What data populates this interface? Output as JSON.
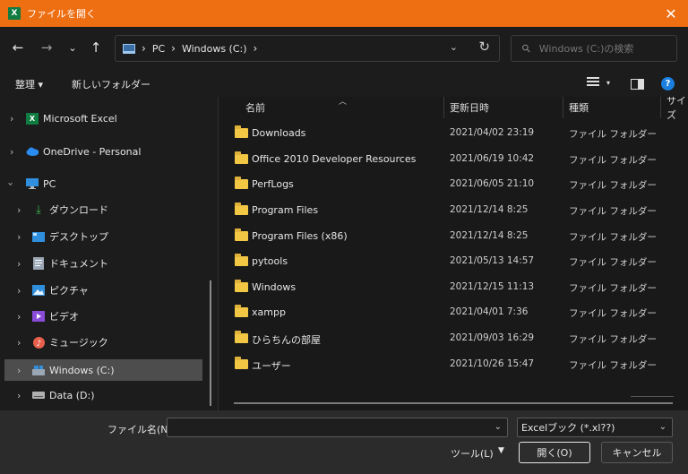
{
  "window": {
    "title": "ファイルを開く",
    "app_badge": "X"
  },
  "nav": {
    "breadcrumb": [
      "PC",
      "Windows (C:)"
    ],
    "search_placeholder": "Windows (C:)の検索"
  },
  "toolbar": {
    "organize_label": "整理 ▾",
    "new_folder_label": "新しいフォルダー",
    "help_label": "?"
  },
  "sidebar": {
    "items": [
      {
        "label": "Microsoft Excel",
        "icon": "excel-icon"
      },
      {
        "label": "OneDrive - Personal",
        "icon": "cloud-icon"
      },
      {
        "label": "PC",
        "icon": "pc-icon"
      },
      {
        "label": "ダウンロード",
        "icon": "download-icon"
      },
      {
        "label": "デスクトップ",
        "icon": "desktop-icon"
      },
      {
        "label": "ドキュメント",
        "icon": "document-icon"
      },
      {
        "label": "ピクチャ",
        "icon": "picture-icon"
      },
      {
        "label": "ビデオ",
        "icon": "video-icon"
      },
      {
        "label": "ミュージック",
        "icon": "music-icon"
      },
      {
        "label": "Windows (C:)",
        "icon": "drive-icon",
        "selected": true
      },
      {
        "label": "Data (D:)",
        "icon": "drive-icon"
      }
    ]
  },
  "columns": {
    "name": "名前",
    "date": "更新日時",
    "type": "種類",
    "size": "サイズ"
  },
  "files": [
    {
      "name": "Downloads",
      "date": "2021/04/02 23:19",
      "type": "ファイル フォルダー"
    },
    {
      "name": "Office 2010 Developer Resources",
      "date": "2021/06/19 10:42",
      "type": "ファイル フォルダー"
    },
    {
      "name": "PerfLogs",
      "date": "2021/06/05 21:10",
      "type": "ファイル フォルダー"
    },
    {
      "name": "Program Files",
      "date": "2021/12/14 8:25",
      "type": "ファイル フォルダー"
    },
    {
      "name": "Program Files (x86)",
      "date": "2021/12/14 8:25",
      "type": "ファイル フォルダー"
    },
    {
      "name": "pytools",
      "date": "2021/05/13 14:57",
      "type": "ファイル フォルダー"
    },
    {
      "name": "Windows",
      "date": "2021/12/15 11:13",
      "type": "ファイル フォルダー"
    },
    {
      "name": "xampp",
      "date": "2021/04/01 7:36",
      "type": "ファイル フォルダー"
    },
    {
      "name": "ひらちんの部屋",
      "date": "2021/09/03 16:29",
      "type": "ファイル フォルダー"
    },
    {
      "name": "ユーザー",
      "date": "2021/10/26 15:47",
      "type": "ファイル フォルダー"
    }
  ],
  "footer": {
    "filename_label": "ファイル名(N):",
    "filename_value": "",
    "filetype_value": "Excelブック (*.xl??)",
    "tools_label": "ツール(L)",
    "open_label": "開く(O)",
    "cancel_label": "キャンセル"
  },
  "colors": {
    "titlebar": "#ee6e12",
    "folder": "#f2c744",
    "selected": "#4d4d4d",
    "help": "#1a7fe0"
  }
}
